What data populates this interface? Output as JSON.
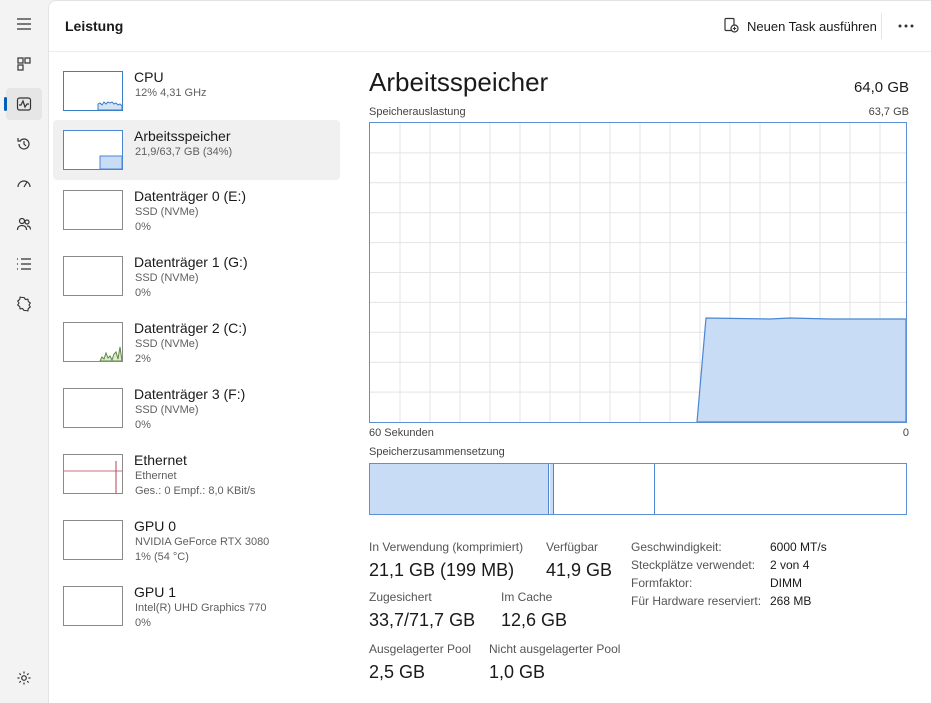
{
  "nav": {
    "items": [
      {
        "name": "hamburger-menu-icon"
      },
      {
        "name": "processes-icon"
      },
      {
        "name": "performance-icon",
        "active": true
      },
      {
        "name": "app-history-icon"
      },
      {
        "name": "startup-apps-icon"
      },
      {
        "name": "users-icon"
      },
      {
        "name": "details-icon"
      },
      {
        "name": "services-icon"
      }
    ],
    "settings": {
      "name": "settings-icon"
    }
  },
  "header": {
    "title": "Leistung",
    "run_task_label": "Neuen Task ausführen"
  },
  "sidebar": {
    "items": [
      {
        "title": "CPU",
        "line1": "12%  4,31 GHz",
        "line2": ""
      },
      {
        "title": "Arbeitsspeicher",
        "line1": "21,9/63,7 GB (34%)",
        "line2": ""
      },
      {
        "title": "Datenträger 0 (E:)",
        "line1": "SSD (NVMe)",
        "line2": "0%"
      },
      {
        "title": "Datenträger 1 (G:)",
        "line1": "SSD (NVMe)",
        "line2": "0%"
      },
      {
        "title": "Datenträger 2 (C:)",
        "line1": "SSD (NVMe)",
        "line2": "2%"
      },
      {
        "title": "Datenträger 3 (F:)",
        "line1": "SSD (NVMe)",
        "line2": "0%"
      },
      {
        "title": "Ethernet",
        "line1": "Ethernet",
        "line2": "Ges.: 0  Empf.: 8,0 KBit/s"
      },
      {
        "title": "GPU 0",
        "line1": "NVIDIA GeForce RTX 3080",
        "line2": "1% (54 °C)"
      },
      {
        "title": "GPU 1",
        "line1": "Intel(R) UHD Graphics 770",
        "line2": "0%"
      }
    ]
  },
  "memory": {
    "title": "Arbeitsspeicher",
    "total": "64,0 GB",
    "usage_label": "Speicherauslastung",
    "usage_max": "63,7 GB",
    "time_left": "60 Sekunden",
    "time_right": "0",
    "composition_label": "Speicherzusammensetzung",
    "stats": {
      "in_use_label": "In Verwendung (komprimiert)",
      "in_use_value": "21,1 GB (199 MB)",
      "available_label": "Verfügbar",
      "available_value": "41,9 GB",
      "committed_label": "Zugesichert",
      "committed_value": "33,7/71,7 GB",
      "cached_label": "Im Cache",
      "cached_value": "12,6 GB",
      "paged_label": "Ausgelagerter Pool",
      "paged_value": "2,5 GB",
      "nonpaged_label": "Nicht ausgelagerter Pool",
      "nonpaged_value": "1,0 GB"
    },
    "props": {
      "speed_label": "Geschwindigkeit:",
      "speed_value": "6000 MT/s",
      "slots_label": "Steckplätze verwendet:",
      "slots_value": "2 von 4",
      "form_label": "Formfaktor:",
      "form_value": "DIMM",
      "reserved_label": "Für Hardware reserviert:",
      "reserved_value": "268 MB"
    }
  },
  "colors": {
    "accent": "#005fb8",
    "memory_fill": "#c9dcf6",
    "memory_line": "#4a86d4",
    "disk_line": "#5c8a3b",
    "ethernet_line": "#b5405a",
    "cpu_line": "#3b7fc4"
  }
}
